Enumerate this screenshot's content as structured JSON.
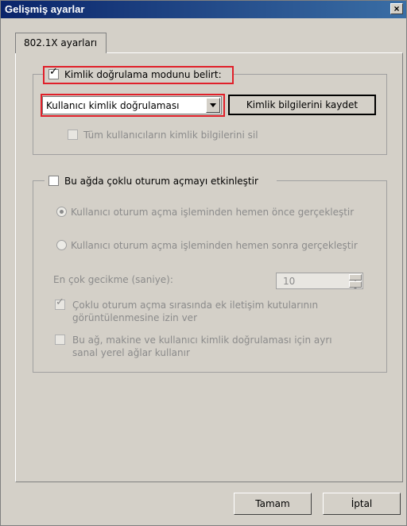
{
  "window": {
    "title": "Gelişmiş ayarlar",
    "close_label": "×"
  },
  "tabs": [
    {
      "label": "802.1X ayarları"
    }
  ],
  "auth_group": {
    "checkbox_label": "Kimlik doğrulama modunu belirt:",
    "checkbox_checked": true,
    "mode_select_value": "Kullanıcı kimlik doğrulaması",
    "save_credentials_label": "Kimlik bilgilerini kaydet",
    "delete_credentials_label": "Tüm kullanıcıların kimlik bilgilerini sil"
  },
  "sso_group": {
    "checkbox_label": "Bu ağda çoklu oturum açmayı etkinleştir",
    "radio_before_label": "Kullanıcı oturum açma işleminden hemen önce gerçekleştir",
    "radio_after_label": "Kullanıcı oturum açma işleminden hemen sonra gerçekleştir",
    "max_delay_label": "En çok gecikme (saniye):",
    "max_delay_value": "10",
    "allow_dialogs_label_line1": "Çoklu oturum açma sırasında ek iletişim kutularının",
    "allow_dialogs_label_line2": "görüntülenmesine izin ver",
    "separate_vlan_label_line1": "Bu ağ, makine ve kullanıcı kimlik doğrulaması için ayrı",
    "separate_vlan_label_line2": "sanal yerel ağlar kullanır"
  },
  "footer": {
    "ok_label": "Tamam",
    "cancel_label": "İptal"
  },
  "colors": {
    "titlebar": "#0a246a",
    "highlight": "#e0202a",
    "dialog_bg": "#d4d0c8"
  },
  "icons": {
    "close": "close-icon",
    "dropdown": "chevron-down-icon",
    "spin_up": "spin-up-icon",
    "spin_down": "spin-down-icon"
  }
}
